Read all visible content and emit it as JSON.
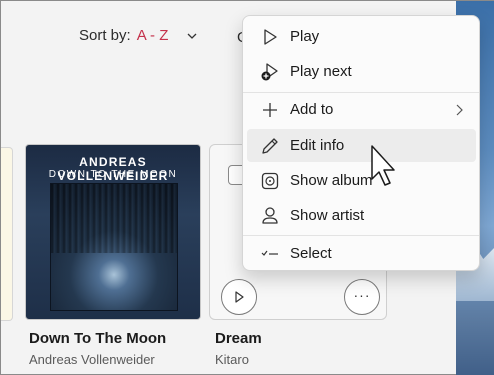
{
  "toolbar": {
    "sort_label": "Sort by:",
    "sort_value": "A - Z",
    "filter_partial": "G"
  },
  "albums": [
    {
      "art_artist": "ANDREAS VOLLENWEIDER",
      "art_title": "DOWN TO THE MOON",
      "title": "Down To The Moon",
      "artist": "Andreas Vollenweider"
    },
    {
      "title": "Dream",
      "artist": "Kitaro"
    }
  ],
  "context_menu": {
    "items": [
      {
        "label": "Play",
        "icon": "play-icon"
      },
      {
        "label": "Play next",
        "icon": "play-next-icon"
      },
      {
        "label": "Add to",
        "icon": "plus-icon",
        "submenu": true
      },
      {
        "label": "Edit info",
        "icon": "pencil-icon",
        "hovered": true
      },
      {
        "label": "Show album",
        "icon": "album-icon"
      },
      {
        "label": "Show artist",
        "icon": "person-icon"
      },
      {
        "label": "Select",
        "icon": "checklist-icon"
      }
    ]
  },
  "colors": {
    "accent": "#c4314b",
    "menu_bg": "#fbfbfb",
    "hover_bg": "#ececec"
  }
}
